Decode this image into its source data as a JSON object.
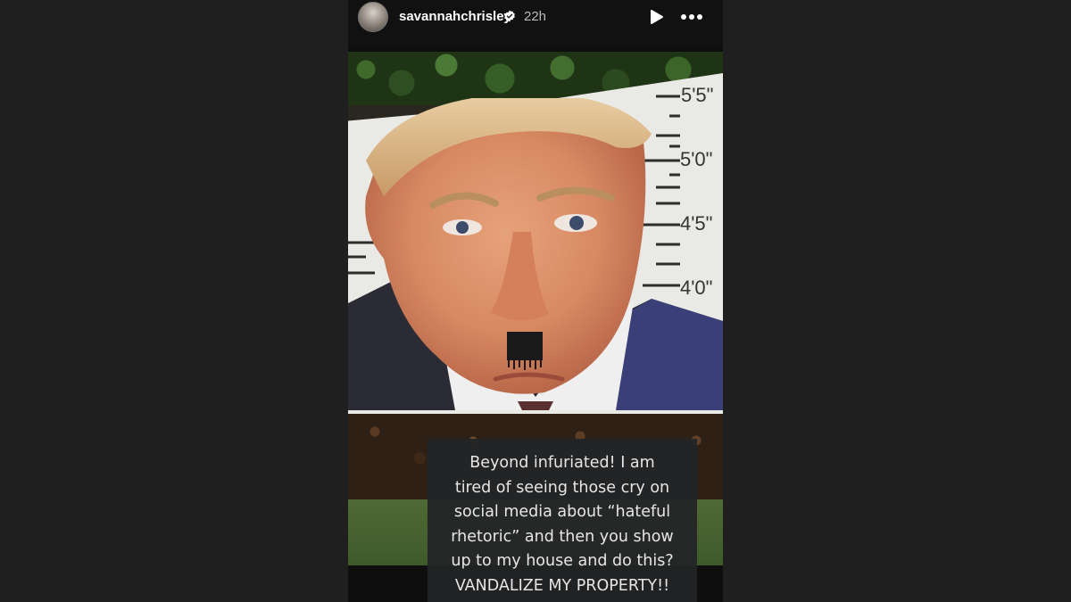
{
  "story": {
    "username": "savannahchrisley",
    "timestamp": "22h",
    "verified": true,
    "icons": {
      "verified": "verified-badge-icon",
      "play": "play-icon",
      "more": "more-options-icon",
      "avatar": "profile-avatar"
    }
  },
  "photo": {
    "height_chart": [
      "5'5\"",
      "5'0\"",
      "4'5\"",
      "4'0\""
    ]
  },
  "caption": {
    "lines": [
      "Beyond infuriated! I am",
      "tired of seeing those cry on",
      "social media about “hateful",
      "rhetoric” and then you show",
      "up to my house and do this?",
      "VANDALIZE MY PROPERTY!!"
    ]
  },
  "colors": {
    "page_background": "#1e1f1e",
    "story_background": "#0e0e0e",
    "caption_background": "#232426",
    "caption_text": "#e6e6e6"
  }
}
